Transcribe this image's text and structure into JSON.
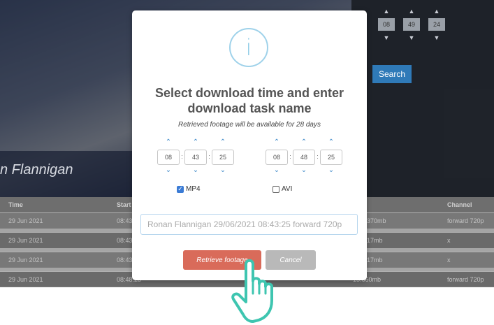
{
  "background": {
    "video_name": "n Flannigan",
    "time_picker": {
      "hours": "08",
      "minutes": "49",
      "seconds": "24"
    },
    "search_label": "Search",
    "table": {
      "headers": [
        {
          "key": "time",
          "label": "Time"
        },
        {
          "key": "start",
          "label": "Start"
        },
        {
          "key": "channel",
          "label": "Channel"
        }
      ],
      "rows": [
        {
          "time": "29 Jun 2021",
          "start": "08:43",
          "size": "370mb",
          "channel": "forward 720p"
        },
        {
          "time": "29 Jun 2021",
          "start": "08:43",
          "size": "17mb",
          "channel": "x"
        },
        {
          "time": "29 Jun 2021",
          "start": "08:43",
          "size": "17mb",
          "channel": "x"
        },
        {
          "time": "29 Jun 2021",
          "start": "08:48:23",
          "size": "15.660mb",
          "channel": "forward 720p"
        }
      ]
    }
  },
  "modal": {
    "icon_glyph": "i",
    "title": "Select download time and enter download task name",
    "subtitle": "Retrieved footage will be available for 28 days",
    "start_time": {
      "hours": "08",
      "minutes": "43",
      "seconds": "25"
    },
    "end_time": {
      "hours": "08",
      "minutes": "48",
      "seconds": "25"
    },
    "formats": [
      {
        "label": "MP4",
        "checked": true
      },
      {
        "label": "AVI",
        "checked": false
      }
    ],
    "task_name_placeholder": "Ronan Flannigan 29/06/2021 08:43:25 forward 720p",
    "retrieve_label": "Retrieve footage",
    "cancel_label": "Cancel"
  },
  "colors": {
    "retrieve_button": "#d96b5a",
    "cancel_button": "#b9b9b9",
    "info_icon": "#9fd2ea",
    "hand_cursor": "#3ec5b0",
    "arrow_blue": "#3a87c8"
  },
  "icons": {
    "info": "info-circle-icon",
    "up": "chevron-up-icon",
    "down": "chevron-down-icon",
    "cursor": "hand-pointer-icon"
  }
}
